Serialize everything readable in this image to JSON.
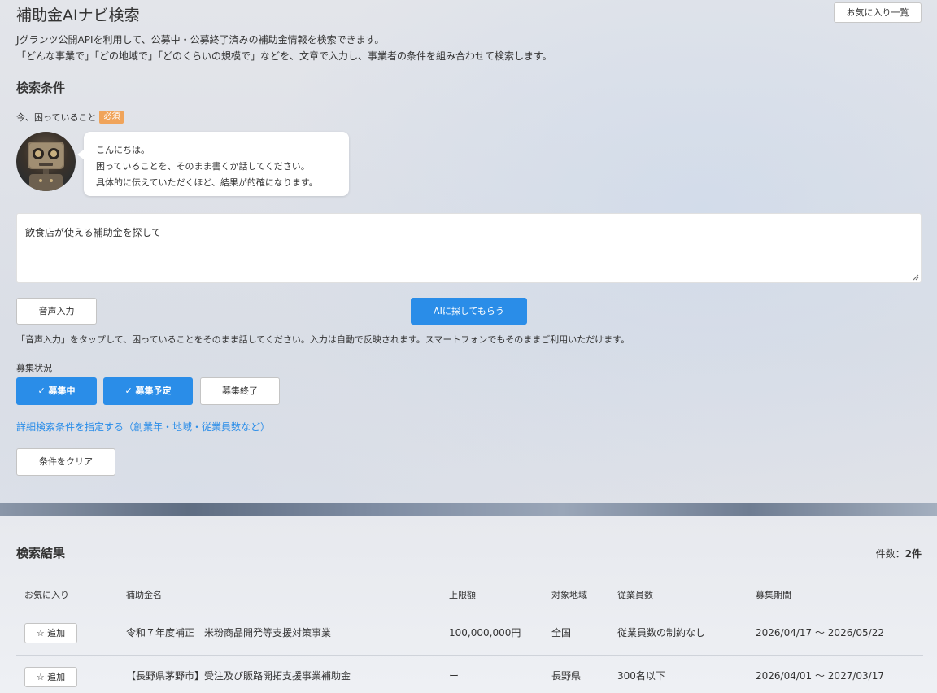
{
  "header": {
    "title": "補助金AIナビ検索",
    "favorites_button": "お気に入り一覧",
    "description_line1": "Jグランツ公開APIを利用して、公募中・公募終了済みの補助金情報を検索できます。",
    "description_line2": "「どんな事業で」「どの地域で」「どのくらいの規模で」などを、文章で入力し、事業者の条件を組み合わせて検索します。"
  },
  "search": {
    "section_title": "検索条件",
    "problem_label": "今、困っていること",
    "required_badge": "必須",
    "bubble_line1": "こんにちは。",
    "bubble_line2": "困っていることを、そのまま書くか話してください。",
    "bubble_line3": "具体的に伝えていただくほど、結果が的確になります。",
    "query_value": "飲食店が使える補助金を探して",
    "voice_button": "音声入力",
    "ai_button": "AIに探してもらう",
    "voice_hint": "「音声入力」をタップして、困っていることをそのまま話してください。入力は自動で反映されます。スマートフォンでもそのままご利用いただけます。",
    "status_label": "募集状況",
    "status_chips": [
      {
        "label": "✓ 募集中",
        "selected": true
      },
      {
        "label": "✓ 募集予定",
        "selected": true
      },
      {
        "label": "募集終了",
        "selected": false
      }
    ],
    "detail_link": "詳細検索条件を指定する（創業年・地域・従業員数など）",
    "clear_button": "条件をクリア"
  },
  "results": {
    "section_title": "検索結果",
    "count_label": "件数：",
    "count_value": "2件",
    "columns": [
      "お気に入り",
      "補助金名",
      "上限額",
      "対象地域",
      "従業員数",
      "募集期間"
    ],
    "rows": [
      {
        "add_label": "☆ 追加",
        "name": "令和７年度補正　米粉商品開発等支援対策事業",
        "limit": "100,000,000円",
        "region": "全国",
        "employees": "従業員数の制約なし",
        "period": "2026/04/17 ～ 2026/05/22"
      },
      {
        "add_label": "☆ 追加",
        "name": "【長野県茅野市】受注及び販路開拓支援事業補助金",
        "limit": "ー",
        "region": "長野県",
        "employees": "300名以下",
        "period": "2026/04/01 ～ 2027/03/17"
      }
    ]
  },
  "colors": {
    "accent": "#2a8de8",
    "required_badge": "#f0a45a"
  }
}
